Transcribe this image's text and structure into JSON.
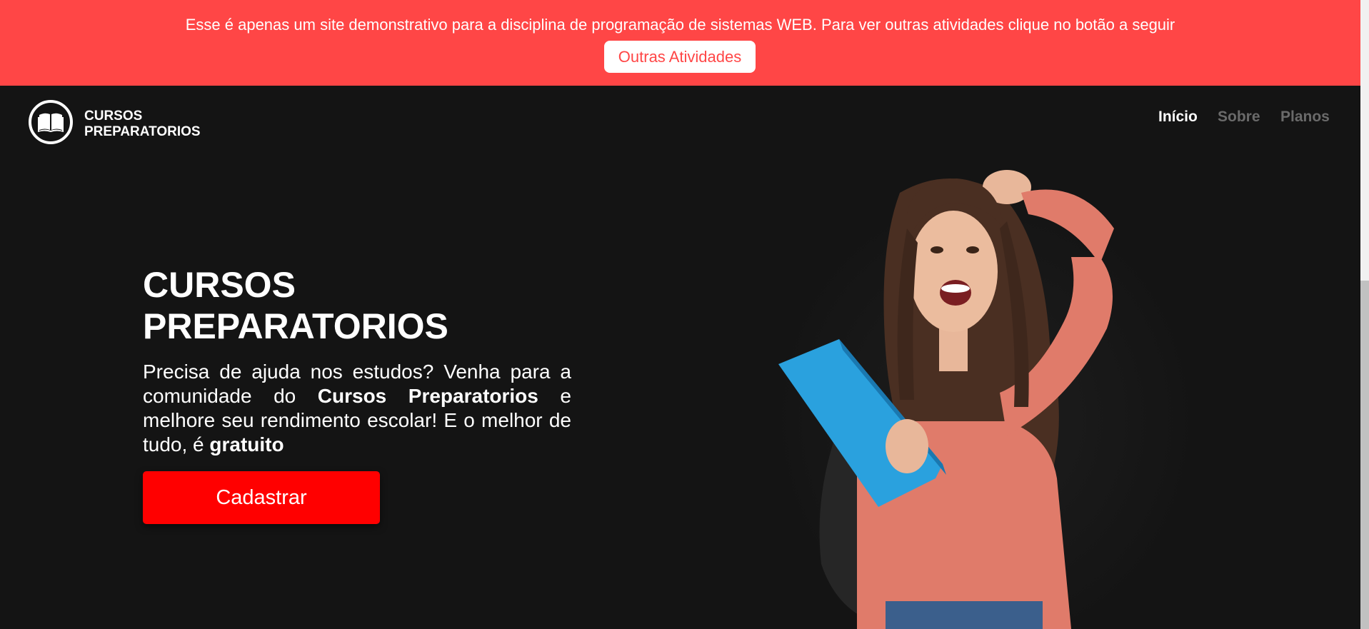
{
  "banner": {
    "message": "Esse é apenas um site demonstrativo para a disciplina de programação de sistemas WEB. Para ver outras atividades clique no botão a seguir",
    "button_label": "Outras Atividades"
  },
  "logo": {
    "line1": "CURSOS",
    "line2": "PREPARATORIOS",
    "icon": "open-book-icon"
  },
  "nav": {
    "items": [
      {
        "label": "Início"
      },
      {
        "label": "Sobre"
      },
      {
        "label": "Planos"
      }
    ]
  },
  "hero": {
    "title_line1": "CURSOS",
    "title_line2": "PREPARATORIOS",
    "desc_part1": "Precisa de ajuda nos estudos? Venha para a comunidade do ",
    "desc_bold1": "Cursos Preparatorios",
    "desc_part2": " e melhore seu rendimento escolar! E o melhor de tudo, é ",
    "desc_bold2": "gratuito",
    "cta_label": "Cadastrar"
  },
  "colors": {
    "banner": "#ff4646",
    "background": "#141414",
    "cta": "#ff0000",
    "nav_inactive": "#6a6a6a"
  }
}
